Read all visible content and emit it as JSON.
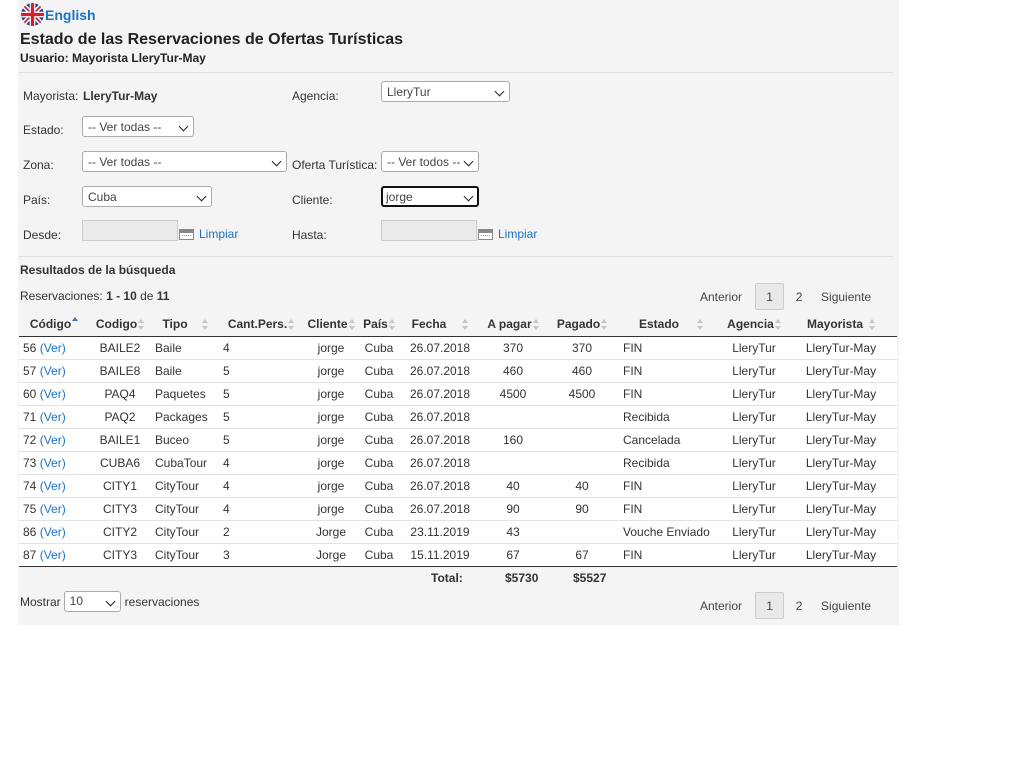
{
  "language": {
    "link": "English",
    "flag": "uk-flag-icon"
  },
  "header": {
    "title": "Estado de las Reservaciones de Ofertas Turísticas",
    "subtitle": "Usuario: Mayorista LleryTur-May"
  },
  "filters": {
    "mayorista_label": "Mayorista:",
    "mayorista_value": "LleryTur-May",
    "agencia_label": "Agencia:",
    "agencia_value": "LleryTur",
    "estado_label": "Estado:",
    "estado_value": "-- Ver todas --",
    "zona_label": "Zona:",
    "zona_value": "-- Ver todas --",
    "oferta_label": "Oferta Turística:",
    "oferta_value": "-- Ver todos --",
    "pais_label": "País:",
    "pais_value": "Cuba",
    "cliente_label": "Cliente:",
    "cliente_value": "jorge",
    "desde_label": "Desde:",
    "hasta_label": "Hasta:",
    "clear_label": "Limpiar"
  },
  "results": {
    "heading": "Resultados de la búsqueda",
    "summary_prefix": "Reservaciones:",
    "summary_range": "1 - 10",
    "summary_de": "de",
    "summary_total": "11"
  },
  "pagination": {
    "prev": "Anterior",
    "current": "1",
    "other": "2",
    "next": "Siguiente"
  },
  "table": {
    "columns": [
      "Código",
      "Codigo",
      "Tipo",
      "Cant.Pers.",
      "Cliente",
      "País",
      "Fecha",
      "A pagar",
      "Pagado",
      "Estado",
      "Agencia",
      "Mayorista"
    ],
    "ver_label": "(Ver)",
    "rows": [
      {
        "id": "56",
        "codigo": "BAILE2",
        "tipo": "Baile",
        "cant": "4",
        "cliente": "jorge",
        "pais": "Cuba",
        "fecha": "26.07.2018",
        "apagar": "370",
        "pagado": "370",
        "estado": "FIN",
        "agencia": "LleryTur",
        "mayorista": "LleryTur-May"
      },
      {
        "id": "57",
        "codigo": "BAILE8",
        "tipo": "Baile",
        "cant": "5",
        "cliente": "jorge",
        "pais": "Cuba",
        "fecha": "26.07.2018",
        "apagar": "460",
        "pagado": "460",
        "estado": "FIN",
        "agencia": "LleryTur",
        "mayorista": "LleryTur-May"
      },
      {
        "id": "60",
        "codigo": "PAQ4",
        "tipo": "Paquetes",
        "cant": "5",
        "cliente": "jorge",
        "pais": "Cuba",
        "fecha": "26.07.2018",
        "apagar": "4500",
        "pagado": "4500",
        "estado": "FIN",
        "agencia": "LleryTur",
        "mayorista": "LleryTur-May"
      },
      {
        "id": "71",
        "codigo": "PAQ2",
        "tipo": "Packages",
        "cant": "5",
        "cliente": "jorge",
        "pais": "Cuba",
        "fecha": "26.07.2018",
        "apagar": "",
        "pagado": "",
        "estado": "Recibida",
        "agencia": "LleryTur",
        "mayorista": "LleryTur-May"
      },
      {
        "id": "72",
        "codigo": "BAILE1",
        "tipo": "Buceo",
        "cant": "5",
        "cliente": "jorge",
        "pais": "Cuba",
        "fecha": "26.07.2018",
        "apagar": "160",
        "pagado": "",
        "estado": "Cancelada",
        "agencia": "LleryTur",
        "mayorista": "LleryTur-May"
      },
      {
        "id": "73",
        "codigo": "CUBA6",
        "tipo": "CubaTour",
        "cant": "4",
        "cliente": "jorge",
        "pais": "Cuba",
        "fecha": "26.07.2018",
        "apagar": "",
        "pagado": "",
        "estado": "Recibida",
        "agencia": "LleryTur",
        "mayorista": "LleryTur-May"
      },
      {
        "id": "74",
        "codigo": "CITY1",
        "tipo": "CityTour",
        "cant": "4",
        "cliente": "jorge",
        "pais": "Cuba",
        "fecha": "26.07.2018",
        "apagar": "40",
        "pagado": "40",
        "estado": "FIN",
        "agencia": "LleryTur",
        "mayorista": "LleryTur-May"
      },
      {
        "id": "75",
        "codigo": "CITY3",
        "tipo": "CityTour",
        "cant": "4",
        "cliente": "jorge",
        "pais": "Cuba",
        "fecha": "26.07.2018",
        "apagar": "90",
        "pagado": "90",
        "estado": "FIN",
        "agencia": "LleryTur",
        "mayorista": "LleryTur-May"
      },
      {
        "id": "86",
        "codigo": "CITY2",
        "tipo": "CityTour",
        "cant": "2",
        "cliente": "Jorge",
        "pais": "Cuba",
        "fecha": "23.11.2019",
        "apagar": "43",
        "pagado": "",
        "estado": "Vouche Enviado",
        "agencia": "LleryTur",
        "mayorista": "LleryTur-May"
      },
      {
        "id": "87",
        "codigo": "CITY3",
        "tipo": "CityTour",
        "cant": "3",
        "cliente": "Jorge",
        "pais": "Cuba",
        "fecha": "15.11.2019",
        "apagar": "67",
        "pagado": "67",
        "estado": "FIN",
        "agencia": "LleryTur",
        "mayorista": "LleryTur-May"
      }
    ],
    "total_label": "Total:",
    "total_apagar": "$5730",
    "total_pagado": "$5527"
  },
  "show": {
    "prefix": "Mostrar",
    "value": "10",
    "suffix": "reservaciones"
  }
}
